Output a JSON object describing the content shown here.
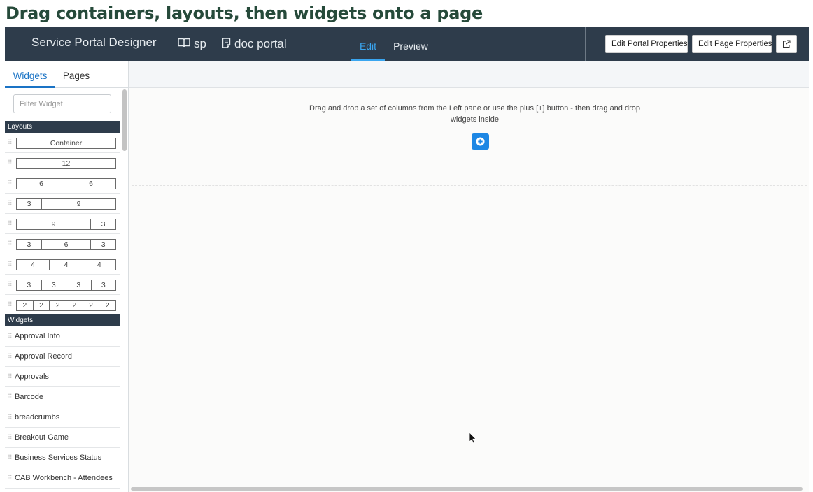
{
  "caption": "Drag containers, layouts, then widgets onto a page",
  "topbar": {
    "title": "Service Portal Designer",
    "portal": "sp",
    "page": "doc portal",
    "tabs": {
      "edit": "Edit",
      "preview": "Preview"
    },
    "buttons": {
      "edit_portal_properties": "Edit Portal Properties",
      "edit_page_properties": "Edit Page Properties"
    },
    "icons": {
      "portal": "book-icon",
      "page": "document-icon",
      "external": "external-link-icon"
    }
  },
  "sidebar": {
    "tabs": {
      "widgets": "Widgets",
      "pages": "Pages"
    },
    "filter_placeholder": "Filter Widget",
    "layouts_header": "Layouts",
    "layouts": {
      "container": [
        "Container"
      ],
      "l12": [
        "12"
      ],
      "l6_6": [
        "6",
        "6"
      ],
      "l3_9": [
        "3",
        "9"
      ],
      "l9_3": [
        "9",
        "3"
      ],
      "l3_6_3": [
        "3",
        "6",
        "3"
      ],
      "l4_4_4": [
        "4",
        "4",
        "4"
      ],
      "l3_3_3_3": [
        "3",
        "3",
        "3",
        "3"
      ],
      "l2x6": [
        "2",
        "2",
        "2",
        "2",
        "2",
        "2"
      ]
    },
    "widgets_header": "Widgets",
    "widgets": [
      "Approval Info",
      "Approval Record",
      "Approvals",
      "Barcode",
      "breadcrumbs",
      "Breakout Game",
      "Business Services Status",
      "CAB Workbench - Attendees"
    ]
  },
  "canvas": {
    "drop_hint": "Drag and drop a set of columns from the Left pane or use the plus [+] button - then drag and drop widgets inside",
    "add_icon": "plus-circle-icon"
  },
  "colors": {
    "topbar_bg": "#2e3c4b",
    "accent": "#3aa6f0",
    "add_button": "#1d87e4",
    "caption": "#264a3a"
  }
}
